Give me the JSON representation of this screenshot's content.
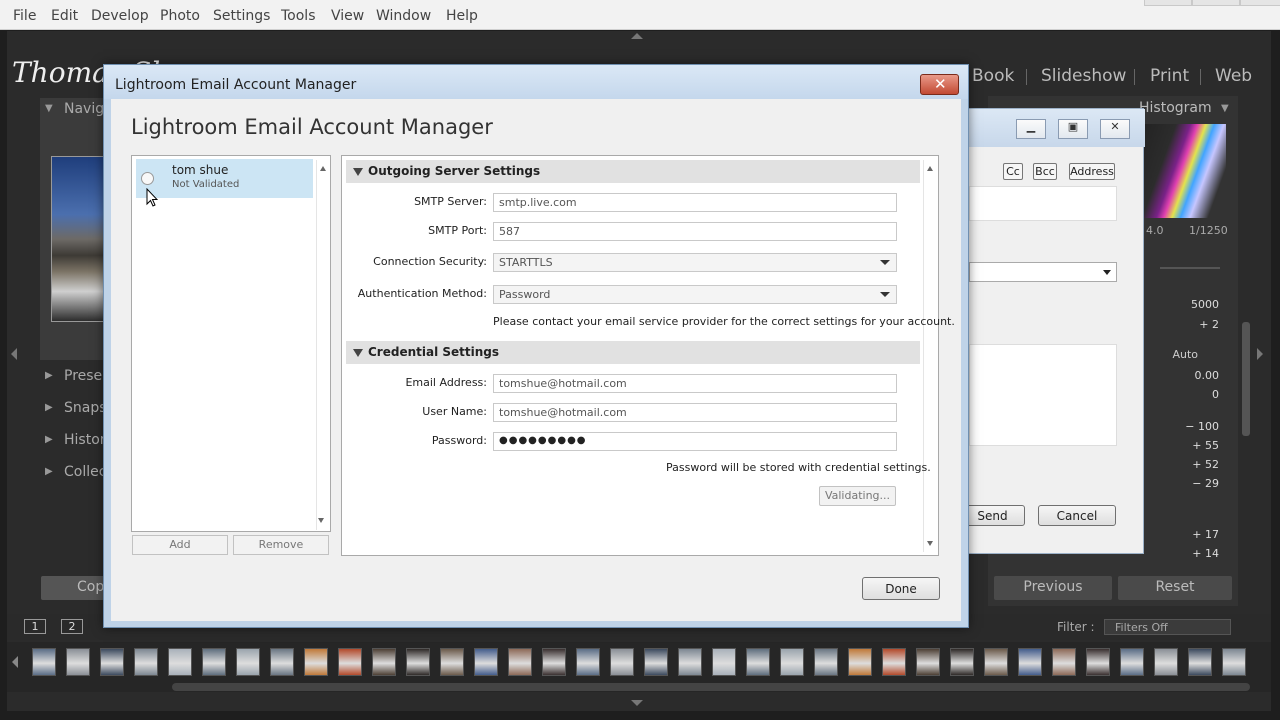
{
  "menubar": {
    "items": [
      "File",
      "Edit",
      "Develop",
      "Photo",
      "Settings",
      "Tools",
      "View",
      "Window",
      "Help"
    ]
  },
  "lightroom": {
    "logo": "Thomas Sl",
    "modules": [
      "Book",
      "Slideshow",
      "Print",
      "Web"
    ],
    "left_panels": [
      "Navig",
      "Prese",
      "Snaps",
      "Histor",
      "Collec"
    ],
    "copy_button": "Cop",
    "histogram_label": "Histogram",
    "exif": [
      "4.0",
      "1/1250"
    ],
    "right_values": [
      "5000",
      "+ 2",
      "Auto",
      "0.00",
      "0",
      "− 100",
      "+ 55",
      "+ 52",
      "− 29",
      "+ 17",
      "+ 14"
    ],
    "previous_button": "Previous",
    "reset_button": "Reset",
    "filter_label": "Filter :",
    "filter_value": "Filters Off",
    "page_buttons": [
      "1",
      "2"
    ]
  },
  "compose": {
    "cc_button": "Cc",
    "bcc_button": "Bcc",
    "address_button": "Address",
    "send_button": "Send",
    "cancel_button": "Cancel"
  },
  "dialog": {
    "window_title": "Lightroom Email Account Manager",
    "heading": "Lightroom Email Account Manager",
    "accounts": [
      {
        "name": "tom shue",
        "status": "Not Validated"
      }
    ],
    "add_button": "Add",
    "remove_button": "Remove",
    "outgoing": {
      "section_title": "Outgoing Server Settings",
      "smtp_server_label": "SMTP Server:",
      "smtp_server_value": "smtp.live.com",
      "smtp_port_label": "SMTP Port:",
      "smtp_port_value": "587",
      "security_label": "Connection Security:",
      "security_value": "STARTTLS",
      "auth_label": "Authentication Method:",
      "auth_value": "Password",
      "note": "Please contact your email service provider for the correct settings for your account."
    },
    "credentials": {
      "section_title": "Credential Settings",
      "email_label": "Email Address:",
      "email_value": "tomshue@hotmail.com",
      "user_label": "User Name:",
      "user_value": "tomshue@hotmail.com",
      "password_label": "Password:",
      "password_value": "●●●●●●●●●",
      "note": "Password will be stored with credential settings.",
      "validate_button": "Validating..."
    },
    "done_button": "Done"
  },
  "colors": {
    "selection": "#cce5f4",
    "close_button": "#c24a33",
    "dialog_frame": "#bfd3e8"
  }
}
